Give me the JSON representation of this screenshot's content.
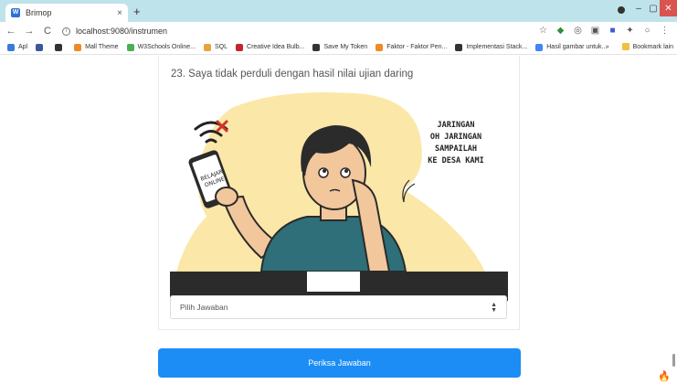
{
  "browser": {
    "tab_title": "Brimop",
    "tab_close": "×",
    "new_tab": "+",
    "window_min": "–",
    "window_max": "▢",
    "window_close": "✕",
    "url": "localhost:9080/instrumen",
    "nav_back": "←",
    "nav_forward": "→",
    "nav_reload": "C"
  },
  "bookmarks": {
    "items": [
      {
        "label": "Apl",
        "icon": "apps-grid-icon",
        "color": "#3b7bd8"
      },
      {
        "label": "",
        "icon": "facebook-icon",
        "color": "#3b5998"
      },
      {
        "label": "",
        "icon": "github-icon",
        "color": "#333333"
      },
      {
        "label": "Mall Theme",
        "icon": "bookmark-icon",
        "color": "#f08a24"
      },
      {
        "label": "W3Schools Online...",
        "icon": "w3schools-icon",
        "color": "#4caf50"
      },
      {
        "label": "SQL",
        "icon": "chart-icon",
        "color": "#e8a33d"
      },
      {
        "label": "Creative Idea Bulb...",
        "icon": "pinterest-icon",
        "color": "#c8232c"
      },
      {
        "label": "Save My Token",
        "icon": "globe-icon",
        "color": "#333333"
      },
      {
        "label": "Faktor - Faktor Pen...",
        "icon": "bookmark-icon",
        "color": "#f08a24"
      },
      {
        "label": "Implementasi Stack...",
        "icon": "pinterest-icon",
        "color": "#333333"
      },
      {
        "label": "Hasil gambar untuk...",
        "icon": "google-icon",
        "color": "#4285f4"
      }
    ],
    "overflow": "»",
    "other_label": "Bookmark lain"
  },
  "page": {
    "question": "23. Saya tidak perduli dengan hasil nilai ujian daring",
    "speech": [
      "JARINGAN",
      "OH JARINGAN",
      "SAMPAILAH",
      "KE DESA KAMI"
    ],
    "phone_text": [
      "BELAJAR",
      "ONLINE"
    ],
    "select_value": "Pilih Jawaban",
    "submit_label": "Periksa Jawaban"
  },
  "colors": {
    "accent": "#1b8df5",
    "illustration_bg": "#fbe7a8",
    "shirt": "#2e6f79",
    "table": "#2b2b2b"
  }
}
